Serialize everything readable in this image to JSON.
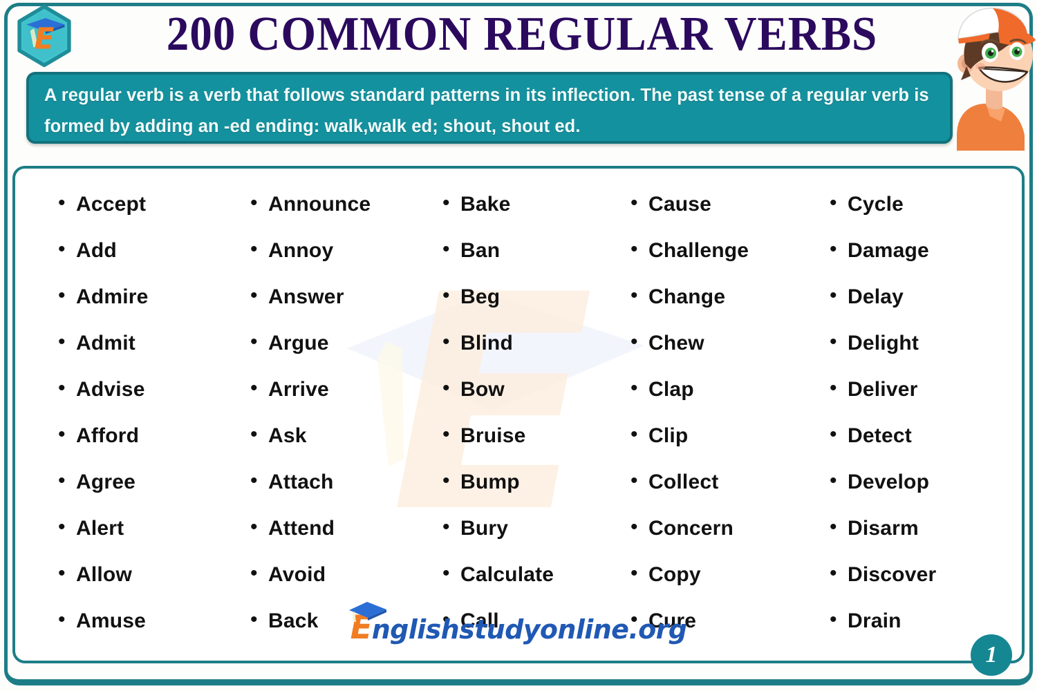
{
  "header": {
    "title": "200 COMMON REGULAR VERBS",
    "logo_icon": "hexagon-e-graduation-cap-logo",
    "mascot_icon": "cartoon-boy-with-cap"
  },
  "description": {
    "text": "A regular verb is a verb that follows standard patterns in its inflection. The past tense of a regular verb is formed by adding an -ed ending: walk,walk ed; shout, shout ed."
  },
  "watermark": {
    "icon": "faint-e-graduation-cap-watermark"
  },
  "verbs": {
    "bullet": "•",
    "columns": [
      {
        "items": [
          "Accept",
          "Add",
          "Admire",
          "Admit",
          "Advise",
          "Afford",
          "Agree",
          "Alert",
          "Allow",
          "Amuse"
        ]
      },
      {
        "items": [
          "Announce",
          "Annoy",
          "Answer",
          "Argue",
          "Arrive",
          "Ask",
          "Attach",
          "Attend",
          "Avoid",
          "Back"
        ]
      },
      {
        "items": [
          "Bake",
          "Ban",
          "Beg",
          "Blind",
          "Bow",
          "Bruise",
          "Bump",
          "Bury",
          "Calculate",
          "Call"
        ]
      },
      {
        "items": [
          "Cause",
          "Challenge",
          "Change",
          "Chew",
          "Clap",
          "Clip",
          "Collect",
          "Concern",
          "Copy",
          "Cure"
        ]
      },
      {
        "items": [
          "Cycle",
          "Damage",
          "Delay",
          "Delight",
          "Deliver",
          "Detect",
          "Develop",
          "Disarm",
          "Discover",
          "Drain"
        ]
      }
    ]
  },
  "footer": {
    "brand_initial": "E",
    "brand_rest": "nglishstudyonline.org",
    "page_number": "1"
  },
  "colors": {
    "teal": "#14919e",
    "teal_dark": "#12727c",
    "frame_teal": "#1d7d86",
    "title_purple": "#2b0a5e",
    "orange": "#f07d23",
    "blue": "#2059b4",
    "badge_teal": "#148793",
    "text_black": "#111111"
  }
}
